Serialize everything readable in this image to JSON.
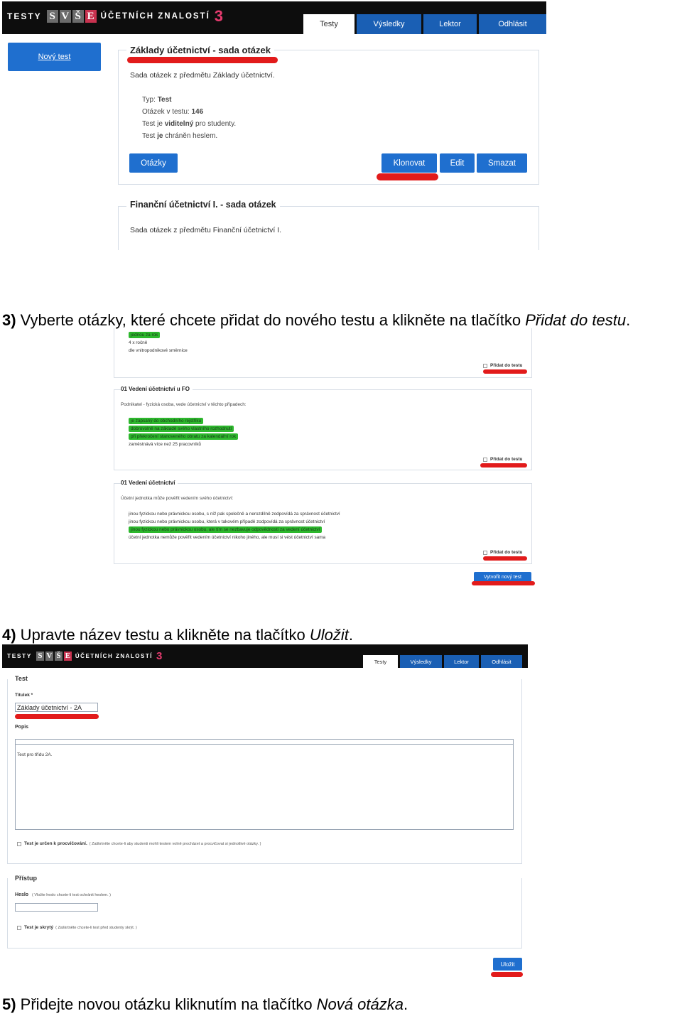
{
  "shot1": {
    "logo": {
      "testy": "TESTY",
      "letters": [
        "S",
        "V",
        "Š",
        "E"
      ],
      "sub": "ÚČETNÍCH ZNALOSTÍ",
      "num": "3"
    },
    "nav": [
      "Testy",
      "Výsledky",
      "Lektor",
      "Odhlásit"
    ],
    "new_test": "Nový test",
    "set1": {
      "title": "Základy účetnictví - sada otázek",
      "desc": "Sada otázek z předmětu Základy účetnictví.",
      "type_label": "Typ:",
      "type_value": "Test",
      "count_label": "Otázek v testu:",
      "count_value": "146",
      "vis_a": "Test je",
      "vis_b": "viditelný",
      "vis_c": "pro studenty.",
      "pw_a": "Test",
      "pw_b": "je",
      "pw_c": "chráněn heslem.",
      "buttons": {
        "questions": "Otázky",
        "clone": "Klonovat",
        "edit": "Edit",
        "delete": "Smazat"
      }
    },
    "set2": {
      "title": "Finanční účetnictví I. - sada otázek",
      "desc": "Sada otázek z předmětu Finanční účetnictví I."
    }
  },
  "step3": {
    "num": "3)",
    "text": " Vyberte otázky, které chcete přidat do nového testu a klikněte na tlačítko ",
    "italic": "Přidat do testu",
    "end": "."
  },
  "shot2": {
    "q0": {
      "answers": [
        {
          "text": "jednou za rok",
          "correct": true
        },
        {
          "text": "4 x ročně",
          "correct": false
        },
        {
          "text": "dle vnitropodnikové směrnice",
          "correct": false
        }
      ]
    },
    "q1": {
      "title": "01 Vedení účetnictví u FO",
      "text": "Podnikatel - fyzická osoba, vede účetnictví v těchto případech:",
      "answers": [
        {
          "text": "je zapsaný do obchodního rejstříku",
          "correct": true
        },
        {
          "text": "dobrovolně na základě svého vlastního rozhodnutí",
          "correct": true
        },
        {
          "text": "při překročení stanoveného obratu za kalendářní rok",
          "correct": true
        },
        {
          "text": "zaměstnává více než 25 pracovníků",
          "correct": false
        }
      ]
    },
    "q2": {
      "title": "01 Vedení účetnictví",
      "text": "Účetní jednotka může pověřit vedením svého účetnictví:",
      "answers": [
        {
          "text": "jinou fyzickou nebo právnickou osobu, s níž pak společně a nerozdílně zodpovídá za správnost účetnictví",
          "correct": false
        },
        {
          "text": "jinou fyzickou nebo právnickou osobu, která v takovém případě zodpovídá za správnost účetnictví",
          "correct": false
        },
        {
          "text": "jinou fyzickou nebo právnickou osobu, ale tím se nezbavuje odpovědnosti za vedení účetnictví",
          "correct": true
        },
        {
          "text": "účetní jednotka nemůže pověřit vedením účetnictví nikoho jiného, ale musí si vést účetnictví sama",
          "correct": false
        }
      ]
    },
    "add_label": "Přidat do testu",
    "create_btn": "Vytvořit nový test"
  },
  "step4": {
    "num": "4)",
    "text": " Upravte název testu a klikněte na tlačítko ",
    "italic": "Uložit",
    "end": "."
  },
  "shot3": {
    "logo": {
      "testy": "TESTY",
      "letters": [
        "S",
        "V",
        "Š",
        "E"
      ],
      "sub": "ÚČETNÍCH ZNALOSTÍ",
      "num": "3"
    },
    "nav": [
      "Testy",
      "Výsledky",
      "Lektor",
      "Odhlásit"
    ],
    "section_test": "Test",
    "title_label": "Titulek *",
    "title_value": "Základy účetnictví - 2A",
    "desc_label": "Popis",
    "desc_value": "Test pro třídu 2A.",
    "practice_a": "Test je určen k procvičování.",
    "practice_b": "( Zaškrtněte chcete-li aby studenti mohli testem volně procházet a procvičovat si jednotlivé otázky. )",
    "section_access": "Přístup",
    "pw_label": "Heslo",
    "pw_hint": "( Vložte heslo chcete-li test ochránit heslem. )",
    "hidden_a": "Test je skrytý",
    "hidden_b": "( Zaškrtněte chcete-li test před studenty skrýt. )",
    "save": "Uložit"
  },
  "step5": {
    "num": "5)",
    "text": " Přidejte novou otázku kliknutím na tlačítko ",
    "italic": "Nová otázka",
    "end": "."
  },
  "colors": {
    "nav_blue": "#1a5fb4",
    "button_blue": "#1f6fcf",
    "highlight_red": "#e21b1b",
    "correct_green": "#2db82d",
    "logo_accent": "#e63b6f"
  }
}
